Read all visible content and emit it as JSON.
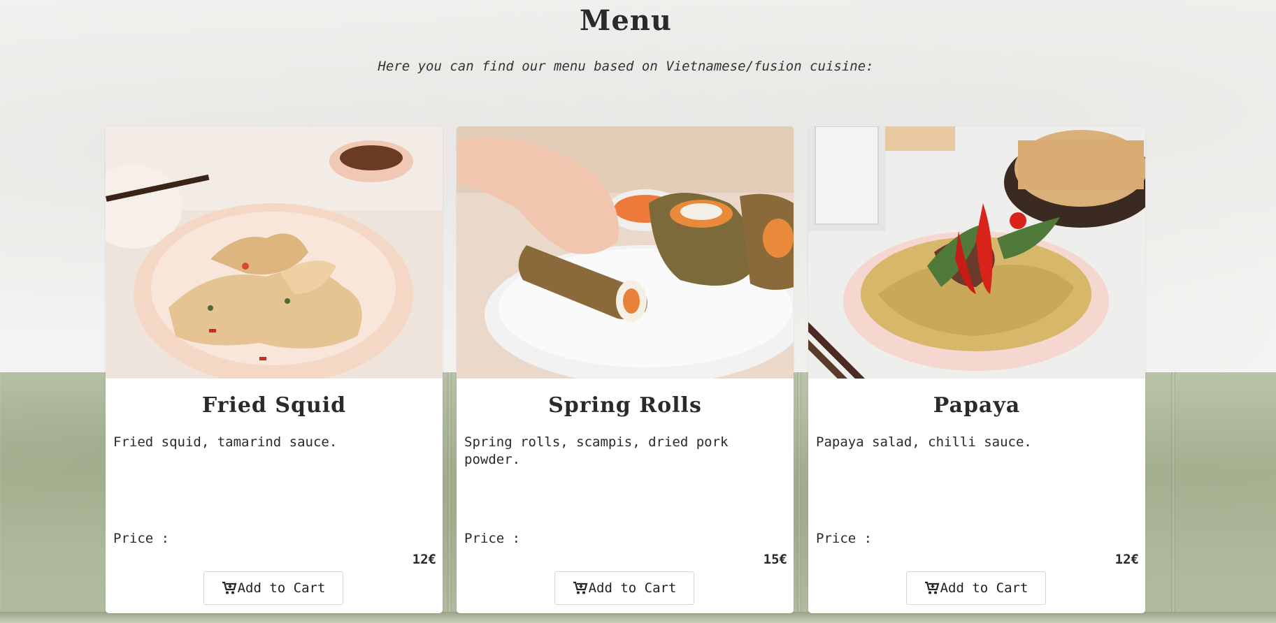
{
  "header": {
    "title": "Menu",
    "subtitle": "Here you can find our menu based on Vietnamese/fusion cuisine:"
  },
  "menu": {
    "items": [
      {
        "name": "Fried Squid",
        "description": "Fried squid, tamarind sauce.",
        "price_label": "Price :",
        "price": "12€",
        "button_label": "Add to Cart",
        "image_icon": "fried-squid-photo"
      },
      {
        "name": "Spring Rolls",
        "description": "Spring rolls, scampis, dried pork powder.",
        "price_label": "Price :",
        "price": "15€",
        "button_label": "Add to Cart",
        "image_icon": "spring-rolls-photo"
      },
      {
        "name": "Papaya",
        "description": "Papaya salad, chilli sauce.",
        "price_label": "Price :",
        "price": "12€",
        "button_label": "Add to Cart",
        "image_icon": "papaya-salad-photo"
      }
    ]
  },
  "colors": {
    "card_background": "#ffffff",
    "text": "#2a2a2a",
    "sofa_green": "#aab596",
    "wall": "#f4f3f1"
  },
  "icons": {
    "cart": "cart-plus-icon"
  }
}
